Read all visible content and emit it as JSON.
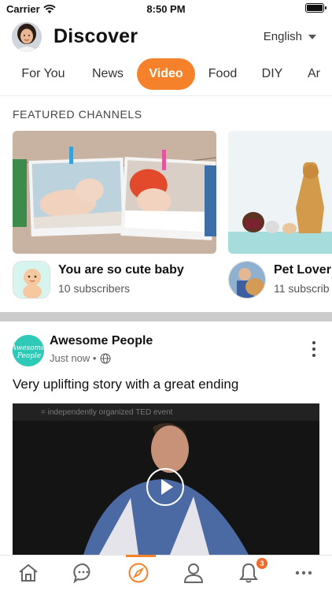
{
  "status_bar": {
    "carrier": "Carrier",
    "time": "8:50 PM"
  },
  "header": {
    "title": "Discover",
    "language": "English"
  },
  "tabs": [
    {
      "label": "For You"
    },
    {
      "label": "News"
    },
    {
      "label": "Video"
    },
    {
      "label": "Food"
    },
    {
      "label": "DIY"
    },
    {
      "label": "Ar"
    }
  ],
  "featured": {
    "title": "FEATURED CHANNELS",
    "channels": [
      {
        "name": "You are so cute baby",
        "subscribers": "10 subscribers"
      },
      {
        "name": "Pet Lover",
        "subscribers": "11 subscrib"
      }
    ]
  },
  "post": {
    "author": "Awesome People",
    "time": "Just now •",
    "text": "Very uplifting story with a great ending",
    "avatar_text": "Awesome People",
    "video_bg_text": "= independently organized TED event"
  },
  "bottom_nav": {
    "items": [
      "home-icon",
      "chat-icon",
      "compass-icon",
      "profile-icon",
      "bell-icon",
      "more-icon"
    ],
    "notification_count": "3"
  },
  "colors": {
    "accent": "#f5822a",
    "badge": "#f26a2a"
  }
}
